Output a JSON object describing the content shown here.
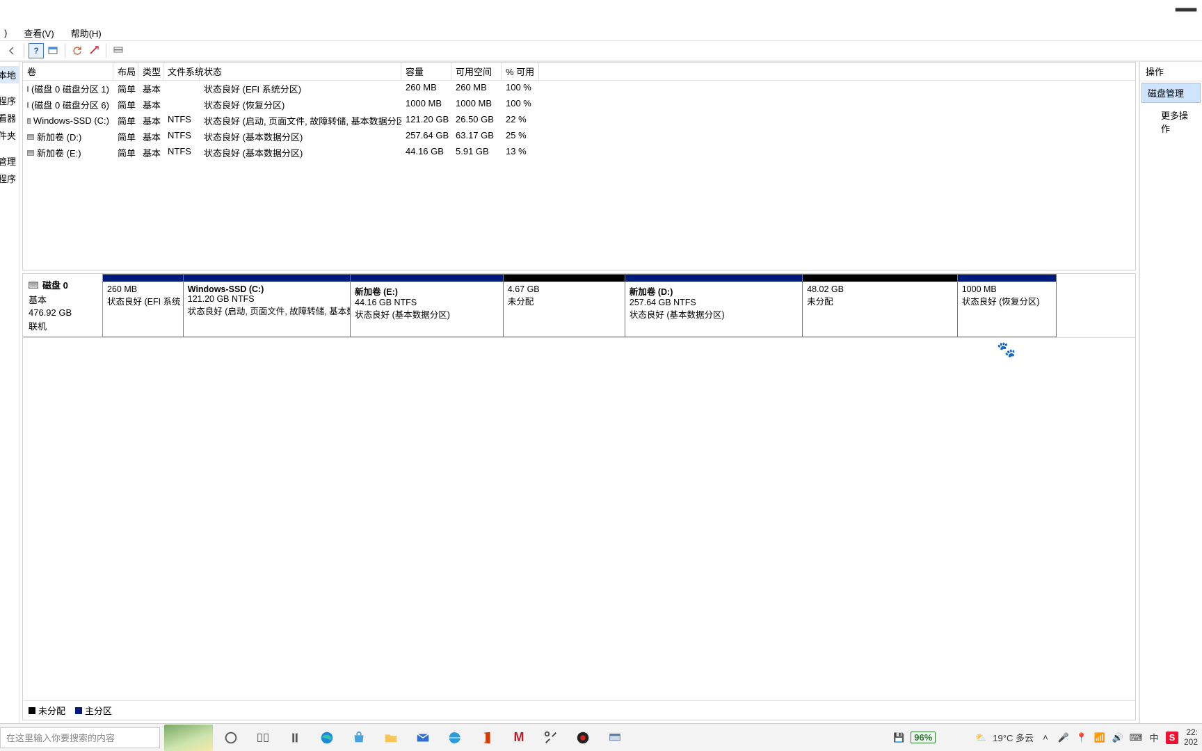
{
  "menubar": {
    "items": [
      "查看(V)",
      "帮助(H)"
    ],
    "prefix": ")"
  },
  "sidebar": {
    "nodes": [
      "本地)",
      "计划程序",
      "查看器",
      "文件夹",
      "管理",
      "用程序"
    ]
  },
  "columns": {
    "vol": "卷",
    "lay": "布局",
    "typ": "类型",
    "fs": "文件系统",
    "stat": "状态",
    "cap": "容量",
    "free": "可用空间",
    "pct": "% 可用"
  },
  "volumes": [
    {
      "name": "(磁盘 0 磁盘分区 1)",
      "layout": "简单",
      "type": "基本",
      "fs": "",
      "status": "状态良好 (EFI 系统分区)",
      "cap": "260 MB",
      "free": "260 MB",
      "pct": "100 %"
    },
    {
      "name": "(磁盘 0 磁盘分区 6)",
      "layout": "简单",
      "type": "基本",
      "fs": "",
      "status": "状态良好 (恢复分区)",
      "cap": "1000 MB",
      "free": "1000 MB",
      "pct": "100 %"
    },
    {
      "name": "Windows-SSD (C:)",
      "layout": "简单",
      "type": "基本",
      "fs": "NTFS",
      "status": "状态良好 (启动, 页面文件, 故障转储, 基本数据分区)",
      "cap": "121.20 GB",
      "free": "26.50 GB",
      "pct": "22 %"
    },
    {
      "name": "新加卷 (D:)",
      "layout": "简单",
      "type": "基本",
      "fs": "NTFS",
      "status": "状态良好 (基本数据分区)",
      "cap": "257.64 GB",
      "free": "63.17 GB",
      "pct": "25 %"
    },
    {
      "name": "新加卷 (E:)",
      "layout": "简单",
      "type": "基本",
      "fs": "NTFS",
      "status": "状态良好 (基本数据分区)",
      "cap": "44.16 GB",
      "free": "5.91 GB",
      "pct": "13 %"
    }
  ],
  "disk": {
    "label": "磁盘 0",
    "type": "基本",
    "size": "476.92 GB",
    "state": "联机",
    "partitions": [
      {
        "name": "",
        "size": "260 MB",
        "line2": "状态良好 (EFI 系统",
        "color": "primary",
        "widthPct": 7.8
      },
      {
        "name": "Windows-SSD  (C:)",
        "size": "121.20 GB NTFS",
        "line2": "状态良好 (启动, 页面文件, 故障转储, 基本数",
        "color": "primary",
        "widthPct": 16.2
      },
      {
        "name": "新加卷  (E:)",
        "size": "44.16 GB NTFS",
        "line2": "状态良好 (基本数据分区)",
        "color": "primary",
        "widthPct": 14.8
      },
      {
        "name": "",
        "size": "4.67 GB",
        "line2": "未分配",
        "color": "unalloc",
        "widthPct": 11.8
      },
      {
        "name": "新加卷  (D:)",
        "size": "257.64 GB NTFS",
        "line2": "状态良好 (基本数据分区)",
        "color": "primary",
        "widthPct": 17.2
      },
      {
        "name": "",
        "size": "48.02 GB",
        "line2": "未分配",
        "color": "unalloc",
        "widthPct": 15.0
      },
      {
        "name": "",
        "size": "1000 MB",
        "line2": "状态良好 (恢复分区)",
        "color": "primary",
        "widthPct": 9.6
      }
    ]
  },
  "legend": {
    "un": "未分配",
    "pr": "主分区"
  },
  "actions": {
    "header": "操作",
    "selected": "磁盘管理",
    "more": "更多操作"
  },
  "taskbar": {
    "search_placeholder": "在这里输入你要搜索的内容",
    "weather": "19°C 多云",
    "battery": "96%",
    "time": "22:",
    "date": "202"
  }
}
